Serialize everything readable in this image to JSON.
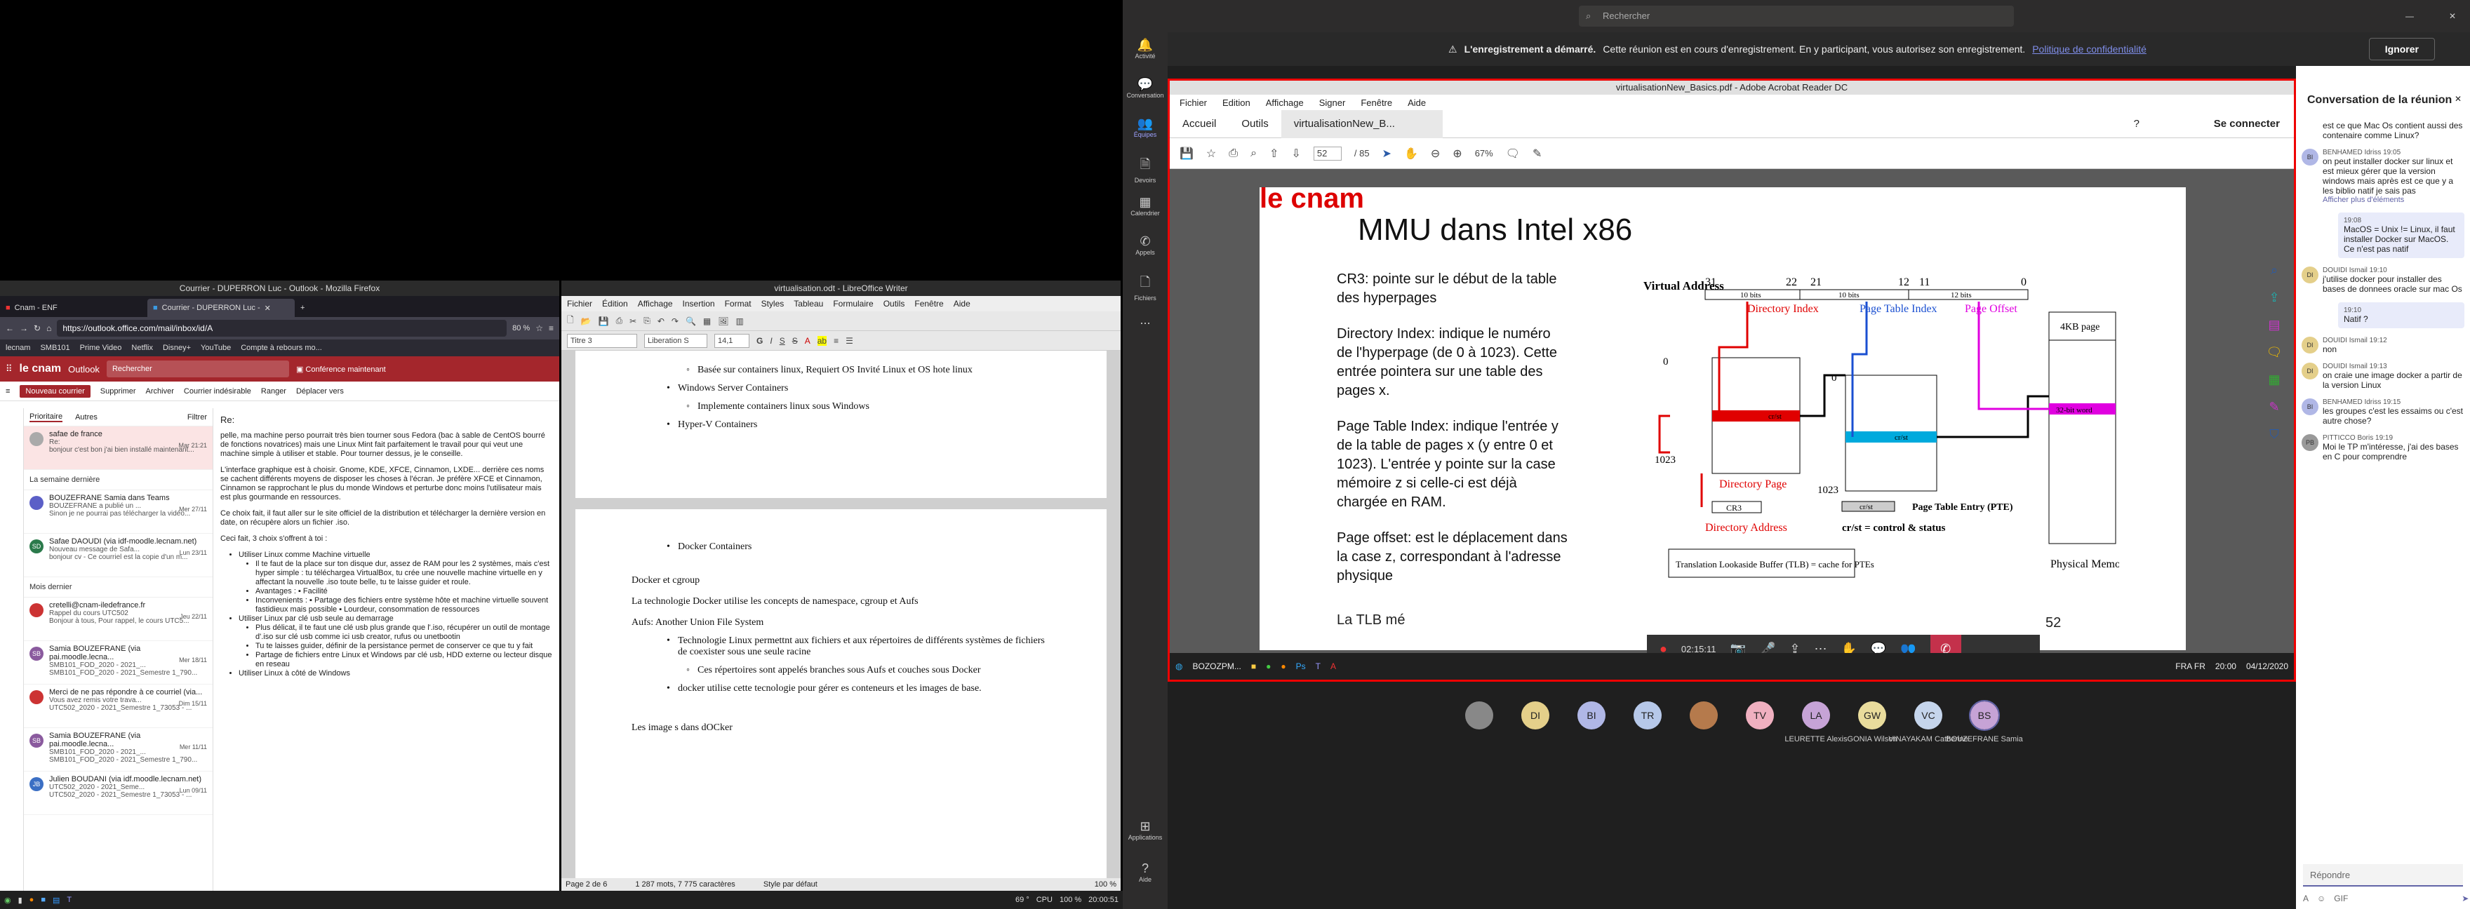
{
  "firefox": {
    "window_title": "Courrier - DUPERRON Luc - Outlook - Mozilla Firefox",
    "tabs": [
      {
        "label": "Cnam - ENF"
      },
      {
        "label": "Courrier - DUPERRON Luc -"
      }
    ],
    "url": "https://outlook.office.com/mail/inbox/id/A",
    "zoom": "80 %",
    "bookmarks": [
      "lecnam",
      "SMB101",
      "Prime Video",
      "Netflix",
      "Disney+",
      "YouTube",
      "Compte à rebours mo..."
    ]
  },
  "outlook": {
    "brand": "le cnam",
    "app": "Outlook",
    "search_placeholder": "Rechercher",
    "meeting": "Conférence maintenant",
    "actions": {
      "new": "Nouveau courrier",
      "delete": "Supprimer",
      "archive": "Archiver",
      "junk": "Courrier indésirable",
      "sweep": "Ranger",
      "move": "Déplacer vers"
    },
    "tabs": {
      "primary": "Prioritaire",
      "others": "Autres",
      "filter": "Filtrer"
    },
    "sections": {
      "last_week": "La semaine dernière",
      "last_month": "Mois dernier"
    },
    "mails": [
      {
        "av": "",
        "from": "safae de france",
        "subject": "Re:",
        "preview": "bonjour c'est bon j'ai bien installé maintenant...",
        "date": "Mar 21:21"
      },
      {
        "av": "",
        "from": "BOUZEFRANE Samia dans Teams",
        "subject": "BOUZEFRANE a publié un ...",
        "preview": "Sinon je ne pourrai pas télécharger la vidéo...",
        "date": "Mer 27/11"
      },
      {
        "av": "SD",
        "from": "Safae DAOUDI (via idf-moodle.lecnam.net)",
        "subject": "Nouveau message de Safa...",
        "preview": "bonjour cv - Ce courriel est la copie d'un m...",
        "date": "Lun 23/11"
      }
    ],
    "mails2": [
      {
        "av": "",
        "from": "cretelli@cnam-iledefrance.fr",
        "subject": "Rappel du cours UTC502",
        "preview": "Bonjour à tous, Pour rappel, le cours UTC5...",
        "date": "Jeu 22/11"
      },
      {
        "av": "SB",
        "from": "Samia BOUZEFRANE (via pai.moodle.lecna...",
        "subject": "SMB101_FOD_2020 - 2021_...",
        "preview": "SMB101_FOD_2020 - 2021_Semestre 1_790...",
        "date": "Mer 18/11"
      },
      {
        "av": "",
        "from": "Merci de ne pas répondre à ce courriel (via...",
        "subject": "Vous avez remis votre trava...",
        "preview": "UTC502_2020 - 2021_Semestre 1_73053 - ...",
        "date": "Dim 15/11"
      },
      {
        "av": "SB",
        "from": "Samia BOUZEFRANE (via pai.moodle.lecna...",
        "subject": "SMB101_FOD_2020 - 2021_...",
        "preview": "SMB101_FOD_2020 - 2021_Semestre 1_790...",
        "date": "Mer 11/11"
      },
      {
        "av": "JB",
        "from": "Julien BOUDANI (via idf.moodle.lecnam.net)",
        "subject": "UTC502_2020 - 2021_Seme...",
        "preview": "UTC502_2020 - 2021_Semestre 1_73053 - ...",
        "date": "Lun 09/11"
      }
    ],
    "reading": {
      "re": "Re:",
      "p1": "pelle, ma machine perso pourrait très bien tourner sous Fedora (bac à sable de CentOS bourré de fonctions novatrices) mais une Linux Mint fait parfaitement le travail pour qui veut une machine simple à utiliser et stable. Pour tourner dessus, je le conseille.",
      "p2": "L'interface graphique est à choisir. Gnome, KDE, XFCE, Cinnamon, LXDE... derrière ces noms se cachent différents moyens de disposer les choses à l'écran. Je préfère XFCE et Cinnamon, Cinnamon se rapprochant le plus du monde Windows et perturbe donc moins l'utilisateur mais est plus gourmande en ressources.",
      "p3": "Ce choix fait, il faut aller sur le site officiel de la distribution et télécharger la dernière version en date, on récupère alors un fichier .iso.",
      "p4": "Ceci fait, 3 choix s'offrent à toi :",
      "items": [
        "Utiliser Linux comme Machine virtuelle",
        "Il te faut de la place sur ton disque dur, assez de RAM pour les 2 systèmes, mais c'est hyper simple : tu téléchargea VirtualBox, tu crée une nouvelle machine virtuelle en y affectant la nouvelle .iso toute belle, tu te laisse guider et roule.",
        "Avantages : ▪ Facilité",
        "Inconvenients : ▪ Partage des fichiers entre système hôte et machine virtuelle souvent fastidieux mais possible ▪ Lourdeur, consommation de ressources",
        "Utiliser Linux par clé usb seule au demarrage",
        "Plus délicat, il te faut une clé usb plus grande que l'.iso, récupérer un outil de montage d'.iso sur clé usb comme ici usb creator, rufus ou unetbootin",
        "Tu te laisses guider, définir de la persistance permet de conserver ce que tu y fait",
        "Partage de fichiers entre Linux et Windows par clé usb, HDD externe ou lecteur disque en reseau",
        "Utiliser Linux à côté de Windows"
      ]
    }
  },
  "writer": {
    "window_title": "virtualisation.odt - LibreOffice Writer",
    "menu": [
      "Fichier",
      "Édition",
      "Affichage",
      "Insertion",
      "Format",
      "Styles",
      "Tableau",
      "Formulaire",
      "Outils",
      "Fenêtre",
      "Aide"
    ],
    "style": "Titre 3",
    "font": "Liberation S",
    "size": "14,1",
    "page1": [
      {
        "sub": true,
        "text": "Basée sur containers linux, Requiert OS Invité Linux et OS hote linux"
      },
      {
        "sub": false,
        "text": "Windows Server Containers"
      },
      {
        "sub": true,
        "text": "Implemente containers linux sous Windows"
      },
      {
        "sub": false,
        "text": "Hyper-V Containers"
      }
    ],
    "page2": {
      "li1": "Docker Containers",
      "p1": "Docker et cgroup",
      "p2": "La technologie Docker utilise les concepts de namespace, cgroup et Aufs",
      "p3": "Aufs: Another Union File System",
      "li2": "Technologie Linux permettnt aux fichiers et aux répertoires de différents systèmes de fichiers de coexister sous une seule racine",
      "li3": "Ces répertoires sont appelés branches sous Aufs et couches sous Docker",
      "li4": "docker utilise cette tecnologie pour gérer es conteneurs et les images de base.",
      "p4": "Les image s dans dOCker"
    },
    "status": {
      "page": "Page 2 de 6",
      "words": "1 287 mots, 7 775 caractères",
      "style": "Style par défaut",
      "zoom": "100 %"
    }
  },
  "linux_taskbar": {
    "temp": "69 °",
    "cpu": "CPU",
    "battery": "100 %",
    "clock": "20:00:51"
  },
  "teams": {
    "search": "Rechercher",
    "rail": [
      "Activité",
      "Conversation",
      "Équipes",
      "Devoirs",
      "Calendrier",
      "Appels",
      "Fichiers",
      "...",
      "Applications",
      "Aide"
    ],
    "recording_bold": "L'enregistrement a démarré.",
    "recording_text": "Cette réunion est en cours d'enregistrement. En y participant, vous autorisez son enregistrement.",
    "recording_link": "Politique de confidentialité",
    "ignore": "Ignorer",
    "acrobat": {
      "title": "virtualisationNew_Basics.pdf - Adobe Acrobat Reader DC",
      "menu": [
        "Fichier",
        "Edition",
        "Affichage",
        "Signer",
        "Fenêtre",
        "Aide"
      ],
      "tabs": [
        "Accueil",
        "Outils",
        "virtualisationNew_B..."
      ],
      "connect": "Se connecter",
      "page": "52",
      "pages": "/ 85",
      "zoom": "67%",
      "page_number": "52"
    },
    "slide": {
      "brand": "le cnam",
      "title": "MMU dans Intel x86",
      "cr3": "CR3: pointe sur le début de la table des hyperpages",
      "dir": "Directory Index: indique le numéro de l'hyperpage (de 0 à 1023). Cette entrée pointera sur une table des pages x.",
      "pti": "Page Table Index: indique l'entrée y de la table de pages x (y entre 0 et 1023). L'entrée y pointe sur la case mémoire z si celle-ci est déjà chargée en RAM.",
      "off": "Page offset: est le déplacement dans la case z, correspondant à l'adresse physique",
      "tlb_cut": "La TLB mé",
      "diagram": {
        "va": "Virtual Address",
        "bits": [
          "31",
          "22",
          "21",
          "12",
          "11",
          "0"
        ],
        "b10a": "10 bits",
        "b10b": "10 bits",
        "b12": "12 bits",
        "dir_idx": "Directory Index",
        "pt_idx": "Page Table Index",
        "offset": "Page Offset",
        "zero": "0",
        "n1023": "1023",
        "zero2": "0",
        "n1023b": "1023",
        "crst": "cr/st",
        "crst2": "cr/st",
        "crst3": "cr/st",
        "word": "32-bit word",
        "page4k": "4KB page",
        "dirpage": "Directory Page",
        "cr3": "CR3",
        "diraddr": "Directory Address",
        "crst_legend": "cr/st = control & status",
        "pte": "Page Table Entry (PTE)",
        "tlb": "Translation Lookaside Buffer (TLB) = cache for PTEs",
        "phys": "Physical Memory"
      }
    },
    "call": {
      "timer": "02:15:11"
    },
    "win_taskbar": {
      "lang": "FRA FR",
      "time": "20:00",
      "date": "04/12/2020",
      "search": "BOZOZPM..."
    },
    "participants": [
      {
        "i": "",
        "name": "",
        "color": "#888"
      },
      {
        "i": "DI",
        "name": "",
        "color": "#e4cf8a"
      },
      {
        "i": "BI",
        "name": "",
        "color": "#b0b7e6"
      },
      {
        "i": "TR",
        "name": "",
        "color": "#b6c8e9"
      },
      {
        "i": "",
        "name": "",
        "color": "#b57a4c"
      },
      {
        "i": "TV",
        "name": "",
        "color": "#f0b0c0"
      },
      {
        "i": "LA",
        "name": "LEURETTE Alexis",
        "color": "#c6a3d6"
      },
      {
        "i": "GW",
        "name": "GONIA Wilson",
        "color": "#e9dc9c"
      },
      {
        "i": "VC",
        "name": "VINAYAKAM Catherine",
        "color": "#c5d5ec"
      },
      {
        "i": "BS",
        "name": "BOUZEFRANE Samia",
        "color": "#c6a3d6"
      }
    ],
    "chat": {
      "title": "Conversation de la réunion",
      "items": [
        {
          "type": "other",
          "av": "",
          "who": "",
          "text": "est ce que Mac Os contient aussi des contenaire comme Linux?"
        },
        {
          "type": "other",
          "av": "BI",
          "who": "BENHAMED Idriss 19:05",
          "text": "on peut installer docker sur linux et est mieux gérer que la version windows mais après est ce que y a les biblio natif je sais pas",
          "extra": "Afficher plus d'éléments"
        },
        {
          "type": "mine",
          "who": "19:08",
          "text": "MacOS = Unix != Linux, il faut installer Docker sur MacOS. Ce n'est pas natif"
        },
        {
          "type": "other",
          "av": "DI",
          "who": "DOUIDI Ismail 19:10",
          "text": "j'utilise docker pour installer des bases de donnees oracle sur mac Os"
        },
        {
          "type": "mine",
          "who": "19:10",
          "text": "Natif ?"
        },
        {
          "type": "other",
          "av": "DI",
          "who": "DOUIDI Ismail 19:12",
          "text": "non"
        },
        {
          "type": "other",
          "av": "DI",
          "who": "DOUIDI Ismail 19:13",
          "text": "on craie une image docker a partir de la version Linux"
        },
        {
          "type": "other",
          "av": "BI",
          "who": "BENHAMED Idriss 19:15",
          "text": "les groupes c'est les essaims ou c'est autre chose?"
        },
        {
          "type": "other",
          "av": "PB",
          "who": "PITTICCO Boris 19:19",
          "text": "Moi le TP m'intéresse, j'ai des bases en C pour comprendre"
        }
      ],
      "reply": "Répondre"
    }
  },
  "colors": {
    "cnam_red": "#a4262c",
    "teams_purple": "#6264a7",
    "dir_red": "#e00000",
    "pt_blue": "#1a4fd1",
    "offset_magenta": "#e000e0",
    "cyan": "#00aadd"
  }
}
